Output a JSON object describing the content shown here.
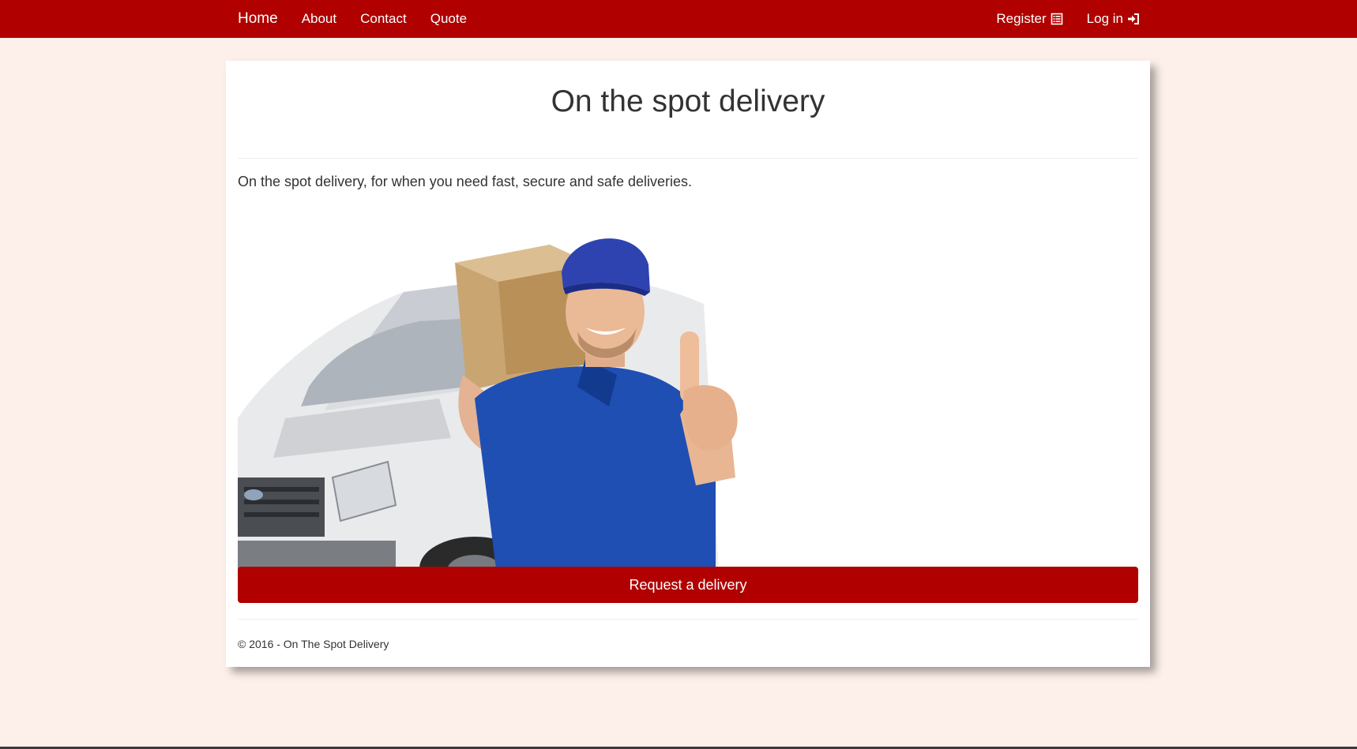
{
  "nav": {
    "brand_label": "Home",
    "links": [
      {
        "label": "About"
      },
      {
        "label": "Contact"
      },
      {
        "label": "Quote"
      }
    ],
    "register_label": "Register",
    "register_icon": "list-alt-icon",
    "login_label": "Log in",
    "login_icon": "log-in-icon"
  },
  "main": {
    "title": "On the spot delivery",
    "tagline": "On the spot delivery, for when you need fast, secure and safe deliveries.",
    "hero_image": "delivery-man-with-box-and-van",
    "cta_label": "Request a delivery"
  },
  "footer": {
    "copyright": "© 2016 - On The Spot Delivery"
  },
  "colors": {
    "brand_red": "#b00000",
    "page_background": "#fdf0ea",
    "card_background": "#ffffff",
    "text": "#333333"
  }
}
